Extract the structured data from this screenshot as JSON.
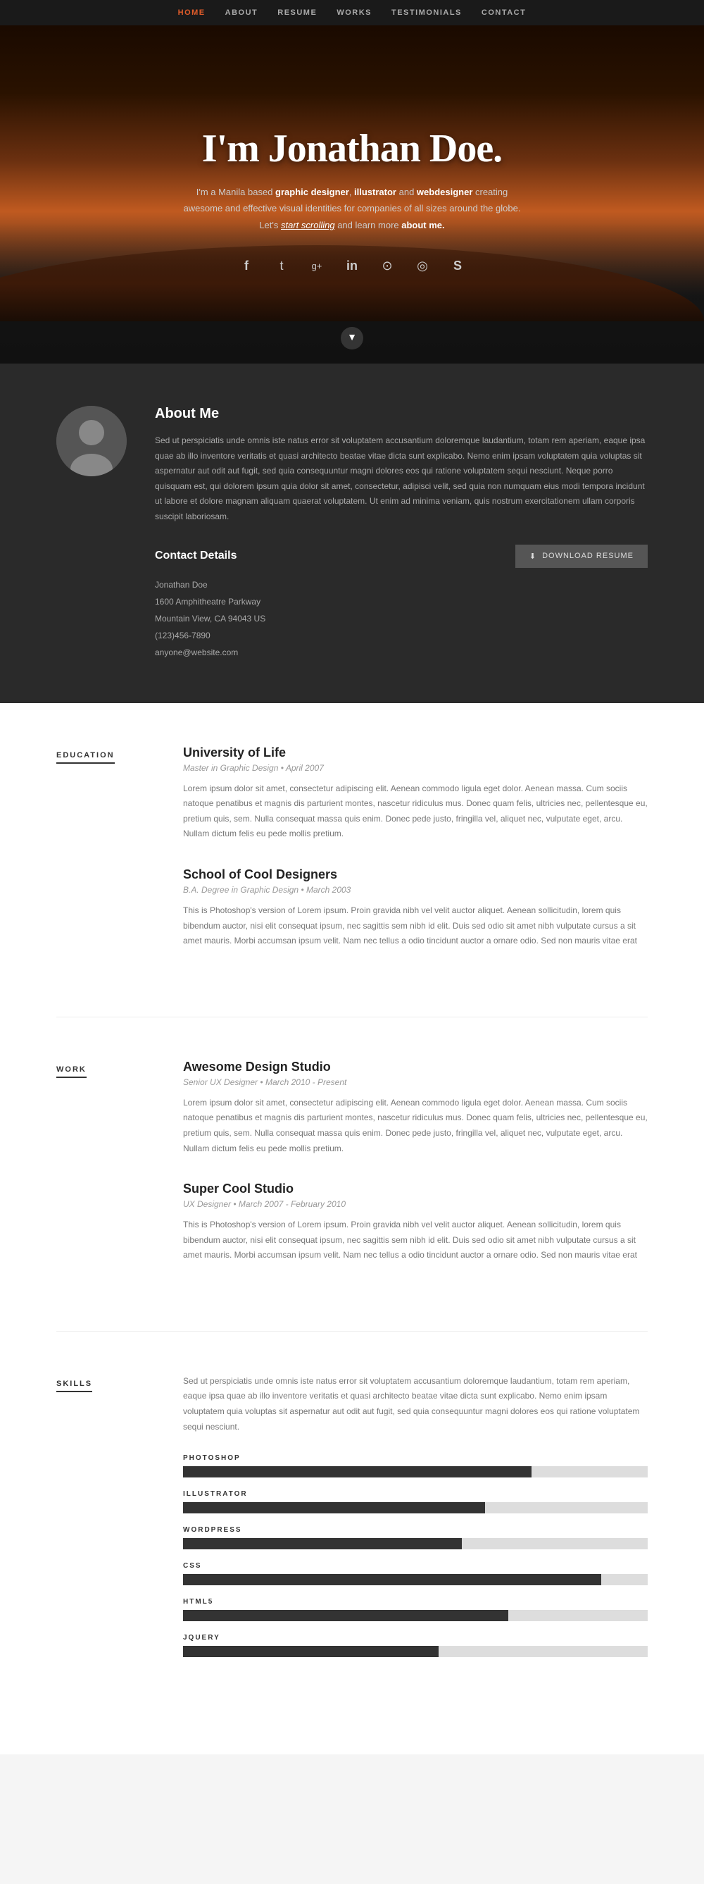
{
  "nav": {
    "items": [
      {
        "label": "HOME",
        "active": true
      },
      {
        "label": "ABOUT",
        "active": false
      },
      {
        "label": "RESUME",
        "active": false
      },
      {
        "label": "WORKS",
        "active": false
      },
      {
        "label": "TESTIMONIALS",
        "active": false
      },
      {
        "label": "CONTACT",
        "active": false
      }
    ]
  },
  "hero": {
    "title": "I'm Jonathan Doe.",
    "subtitle_plain": "I'm a Manila based ",
    "subtitle_bold1": "graphic designer",
    "subtitle_mid1": ", ",
    "subtitle_bold2": "illustrator",
    "subtitle_mid2": " and ",
    "subtitle_bold3": "webdesigner",
    "subtitle_end": " creating awesome and effective visual identities for companies of all sizes around the globe. Let's ",
    "subtitle_link": "start scrolling",
    "subtitle_final": " and learn more ",
    "subtitle_about": "about me.",
    "social": [
      {
        "icon": "f",
        "name": "facebook-icon"
      },
      {
        "icon": "t",
        "name": "twitter-icon"
      },
      {
        "icon": "g+",
        "name": "googleplus-icon"
      },
      {
        "icon": "in",
        "name": "linkedin-icon"
      },
      {
        "icon": "📷",
        "name": "instagram-icon"
      },
      {
        "icon": "🎨",
        "name": "dribbble-icon"
      },
      {
        "icon": "S",
        "name": "skype-icon"
      }
    ],
    "arrow": "▼"
  },
  "about": {
    "title": "About Me",
    "text": "Sed ut perspiciatis unde omnis iste natus error sit voluptatem accusantium doloremque laudantium, totam rem aperiam, eaque ipsa quae ab illo inventore veritatis et quasi architecto beatae vitae dicta sunt explicabo. Nemo enim ipsam voluptatem quia voluptas sit aspernatur aut odit aut fugit, sed quia consequuntur magni dolores eos qui ratione voluptatem sequi nesciunt. Neque porro quisquam est, qui dolorem ipsum quia dolor sit amet, consectetur, adipisci velit, sed quia non numquam eius modi tempora incidunt ut labore et dolore magnam aliquam quaerat voluptatem. Ut enim ad minima veniam, quis nostrum exercitationem ullam corporis suscipit laboriosam.",
    "contact_title": "Contact Details",
    "download_btn": "Download Resume",
    "download_icon": "⬇",
    "name": "Jonathan Doe",
    "address1": "1600 Amphitheatre Parkway",
    "address2": "Mountain View, CA 94043 US",
    "phone": "(123)456-7890",
    "email": "anyone@website.com"
  },
  "education": {
    "label": "EDUCATION",
    "entries": [
      {
        "title": "University of Life",
        "subtitle": "Master in Graphic Design",
        "date": "April 2007",
        "text": "Lorem ipsum dolor sit amet, consectetur adipiscing elit. Aenean commodo ligula eget dolor. Aenean massa. Cum sociis natoque penatibus et magnis dis parturient montes, nascetur ridiculus mus. Donec quam felis, ultricies nec, pellentesque eu, pretium quis, sem. Nulla consequat massa quis enim. Donec pede justo, fringilla vel, aliquet nec, vulputate eget, arcu. Nullam dictum felis eu pede mollis pretium."
      },
      {
        "title": "School of Cool Designers",
        "subtitle": "B.A. Degree in Graphic Design",
        "date": "March 2003",
        "text": "This is Photoshop's version of Lorem ipsum. Proin gravida nibh vel velit auctor aliquet. Aenean sollicitudin, lorem quis bibendum auctor, nisi elit consequat ipsum, nec sagittis sem nibh id elit. Duis sed odio sit amet nibh vulputate cursus a sit amet mauris. Morbi accumsan ipsum velit. Nam nec tellus a odio tincidunt auctor a ornare odio. Sed non mauris vitae erat"
      }
    ]
  },
  "work": {
    "label": "WORK",
    "entries": [
      {
        "title": "Awesome Design Studio",
        "subtitle": "Senior UX Designer",
        "date": "March 2010 - Present",
        "text": "Lorem ipsum dolor sit amet, consectetur adipiscing elit. Aenean commodo ligula eget dolor. Aenean massa. Cum sociis natoque penatibus et magnis dis parturient montes, nascetur ridiculus mus. Donec quam felis, ultricies nec, pellentesque eu, pretium quis, sem. Nulla consequat massa quis enim. Donec pede justo, fringilla vel, aliquet nec, vulputate eget, arcu. Nullam dictum felis eu pede mollis pretium."
      },
      {
        "title": "Super Cool Studio",
        "subtitle": "UX Designer",
        "date": "March 2007 - February 2010",
        "text": "This is Photoshop's version of Lorem ipsum. Proin gravida nibh vel velit auctor aliquet. Aenean sollicitudin, lorem quis bibendum auctor, nisi elit consequat ipsum, nec sagittis sem nibh id elit. Duis sed odio sit amet nibh vulputate cursus a sit amet mauris. Morbi accumsan ipsum velit. Nam nec tellus a odio tincidunt auctor a ornare odio. Sed non mauris vitae erat"
      }
    ]
  },
  "skills": {
    "label": "SKILLS",
    "intro": "Sed ut perspiciatis unde omnis iste natus error sit voluptatem accusantium doloremque laudantium, totam rem aperiam, eaque ipsa quae ab illo inventore veritatis et quasi architecto beatae vitae dicta sunt explicabo. Nemo enim ipsam voluptatem quia voluptas sit aspernatur aut odit aut fugit, sed quia consequuntur magni dolores eos qui ratione voluptatem sequi nesciunt.",
    "items": [
      {
        "name": "PHOTOSHOP",
        "percent": 75
      },
      {
        "name": "ILLUSTRATOR",
        "percent": 65
      },
      {
        "name": "WORDPRESS",
        "percent": 60
      },
      {
        "name": "CSS",
        "percent": 90
      },
      {
        "name": "HTML5",
        "percent": 70
      },
      {
        "name": "JQUERY",
        "percent": 55
      }
    ]
  }
}
